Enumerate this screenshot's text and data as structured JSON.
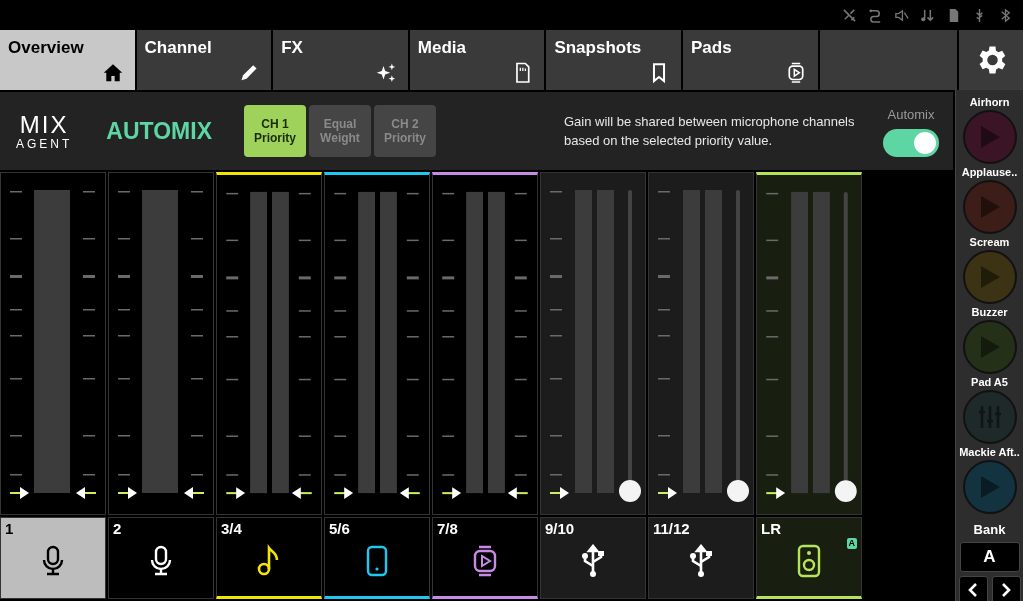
{
  "tabs": [
    {
      "label": "Overview",
      "selected": true
    },
    {
      "label": "Channel",
      "selected": false
    },
    {
      "label": "FX",
      "selected": false
    },
    {
      "label": "Media",
      "selected": false
    },
    {
      "label": "Snapshots",
      "selected": false
    },
    {
      "label": "Pads",
      "selected": false
    }
  ],
  "automix": {
    "logo_top": "MIX",
    "logo_bottom": "AGENT",
    "title": "AUTOMIX",
    "priority_options": [
      {
        "label": "CH 1 Priority",
        "selected": true
      },
      {
        "label": "Equal Weight",
        "selected": false
      },
      {
        "label": "CH 2 Priority",
        "selected": false
      }
    ],
    "description": "Gain will be shared between microphone channels based on the selected priority value.",
    "toggle": {
      "label": "Automix",
      "on": true
    }
  },
  "channels": [
    {
      "label": "1",
      "kind": "mono",
      "selected": true
    },
    {
      "label": "2",
      "kind": "mono",
      "selected": false
    },
    {
      "label": "3/4",
      "kind": "stereo",
      "color": "#f2e600",
      "selected": false
    },
    {
      "label": "5/6",
      "kind": "stereo",
      "color": "#1ec8f0",
      "selected": false
    },
    {
      "label": "7/8",
      "kind": "stereo",
      "color": "#c88ae6",
      "selected": false
    },
    {
      "label": "9/10",
      "kind": "fader",
      "level": 0,
      "selected": false
    },
    {
      "label": "11/12",
      "kind": "fader",
      "level": 0,
      "selected": false
    },
    {
      "label": "LR",
      "kind": "main",
      "color": "#b6e35a",
      "level": 0,
      "badge": "A",
      "selected": false
    }
  ],
  "pads": [
    {
      "name": "Airhorn",
      "kind": "play",
      "color": "#3b1526"
    },
    {
      "name": "Applause..",
      "kind": "play",
      "color": "#3d1d17"
    },
    {
      "name": "Scream",
      "kind": "play",
      "color": "#3b3313"
    },
    {
      "name": "Buzzer",
      "kind": "play",
      "color": "#253019"
    },
    {
      "name": "Pad A5",
      "kind": "mixer",
      "color": "#1e2a29"
    },
    {
      "name": "Mackie Aft..",
      "kind": "play",
      "color": "#133341"
    }
  ],
  "bank": {
    "label": "Bank",
    "value": "A"
  }
}
